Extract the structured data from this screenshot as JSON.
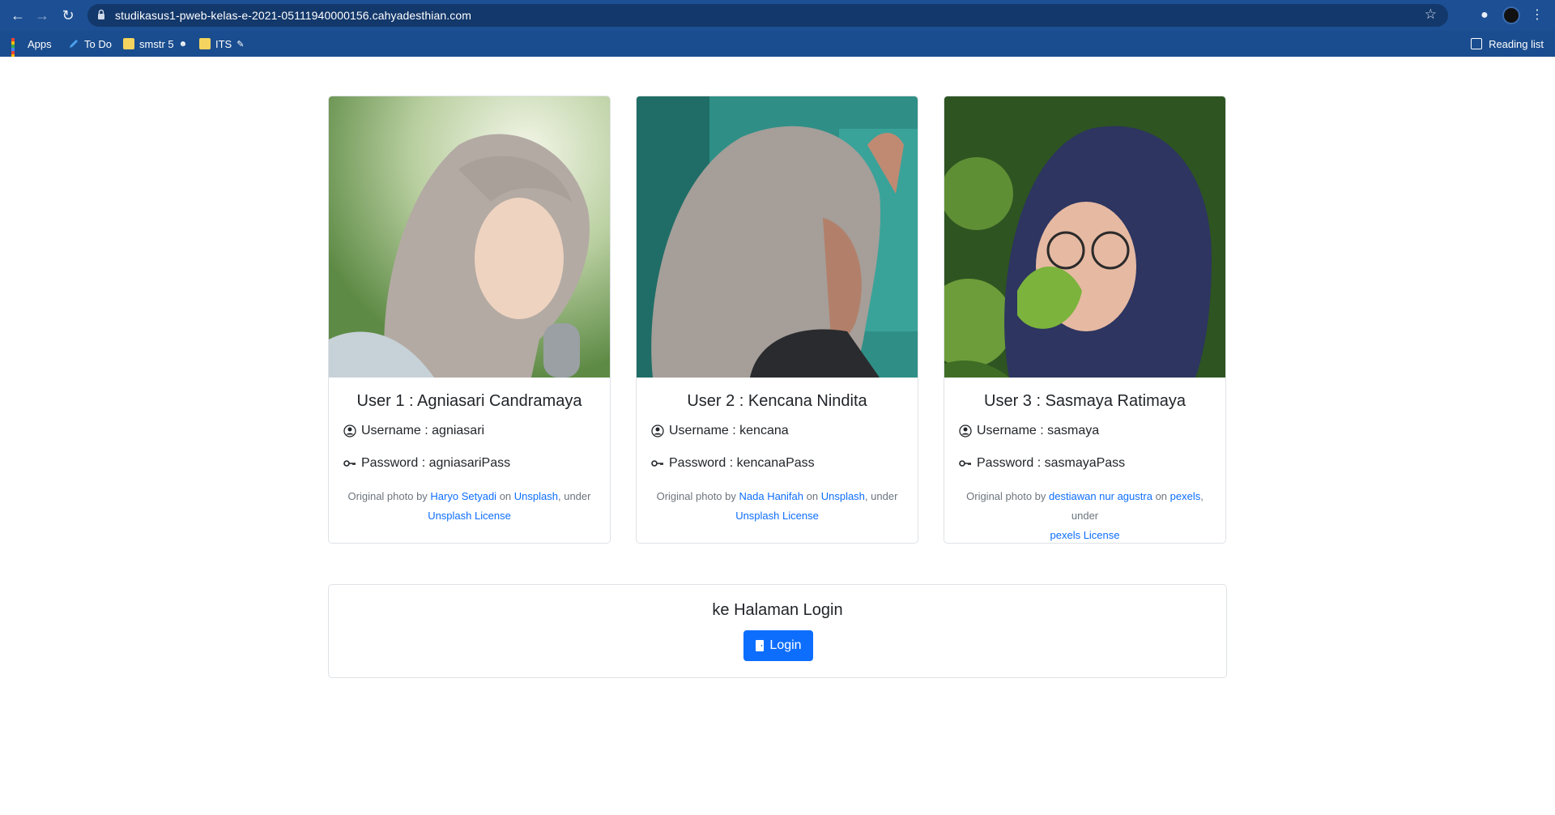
{
  "browser": {
    "url": "studikasus1-pweb-kelas-e-2021-05111940000156.cahyadesthian.com",
    "bookmarks": [
      {
        "label": "Apps",
        "icon": "apps-grid-icon"
      },
      {
        "label": "To Do",
        "icon": "pencil-icon"
      },
      {
        "label": "smstr 5",
        "icon": "folder-icon"
      },
      {
        "label": "ITS",
        "icon": "folder-icon"
      }
    ],
    "reading_list": "Reading list"
  },
  "users": [
    {
      "title": "User 1 : Agniasari Candramaya",
      "username": "Username : agniasari",
      "password": "Password : agniasariPass",
      "credit_prefix": "Original photo by",
      "photographer": "Haryo Setyadi",
      "on": "on",
      "source": "Unsplash",
      "under": ", under",
      "license": "Unsplash License",
      "palette": {
        "bg": "#9fb98a",
        "scarf": "#b5aca4",
        "face": "#efd2bd"
      }
    },
    {
      "title": "User 2 : Kencana Nindita",
      "username": "Username : kencana",
      "password": "Password : kencanaPass",
      "credit_prefix": "Original photo by",
      "photographer": "Nada Hanifah",
      "on": "on",
      "source": "Unsplash",
      "under": ", under",
      "license": "Unsplash License",
      "palette": {
        "bg": "#2f8f86",
        "scarf": "#a59d98",
        "face": "#b58268"
      }
    },
    {
      "title": "User 3 : Sasmaya Ratimaya",
      "username": "Username : sasmaya",
      "password": "Password : sasmayaPass",
      "credit_prefix": "Original photo by",
      "photographer": "destiawan nur agustra",
      "on": "on",
      "source": "pexels",
      "under": ", under",
      "license": "pexels License",
      "palette": {
        "bg": "#3d6b2a",
        "scarf": "#2d3560",
        "face": "#e8b8a0"
      }
    }
  ],
  "login": {
    "title": "ke Halaman Login",
    "button": "Login"
  },
  "colors": {
    "chrome": "#1a4d8f",
    "link": "#0d6efd",
    "button": "#0d6efd"
  }
}
